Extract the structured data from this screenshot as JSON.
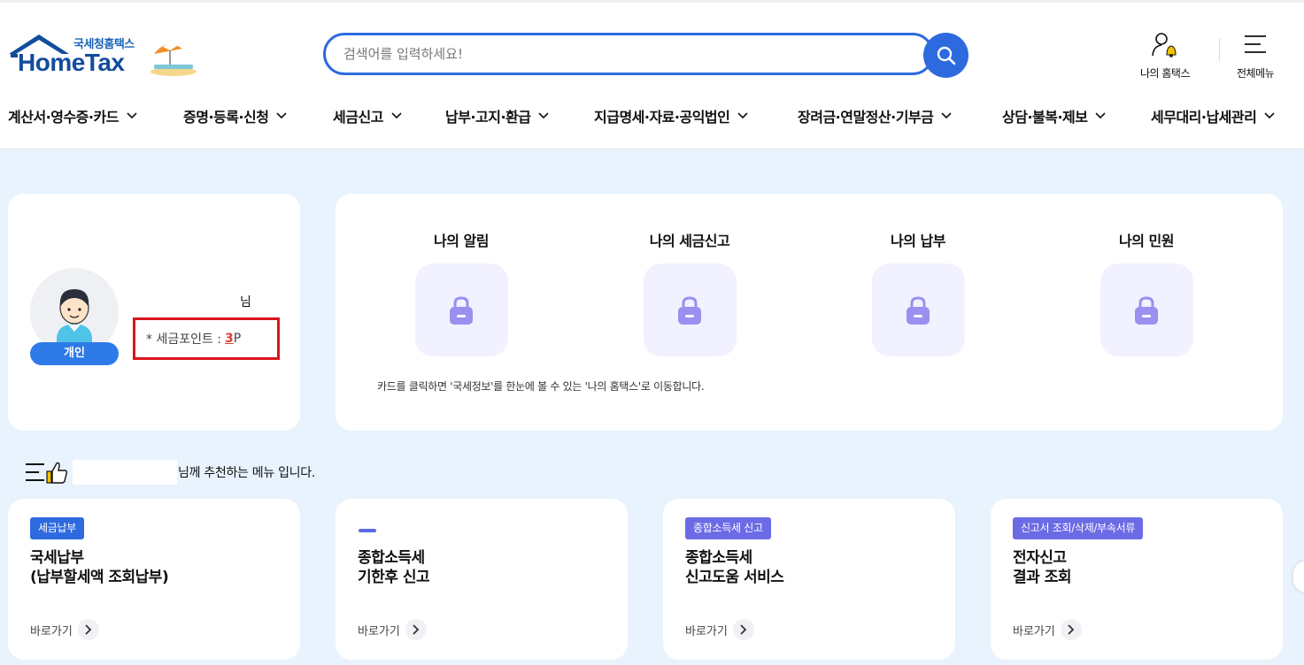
{
  "logo": {
    "sub": "국세청홈택스",
    "main": "HomeTax"
  },
  "search": {
    "placeholder": "검색어를 입력하세요!"
  },
  "util": {
    "my_hometax": "나의 홈택스",
    "all_menu": "전체메뉴"
  },
  "nav": [
    "계산서·영수증·카드",
    "증명·등록·신청",
    "세금신고",
    "납부·고지·환급",
    "지급명세·자료·공익법인",
    "장려금·연말정산·기부금",
    "상담·불복·제보",
    "세무대리·납세관리"
  ],
  "profile": {
    "name_suffix": "님",
    "type_badge": "개인",
    "points_label": "* 세금포인트 :",
    "points_value": "3",
    "points_unit": "P"
  },
  "my": {
    "items": [
      "나의 알림",
      "나의 세금신고",
      "나의 납부",
      "나의 민원"
    ],
    "note": "카드를 클릭하면 '국세정보'를 한눈에 볼 수 있는 '나의 홈택스'로 이동합니다."
  },
  "recommend": {
    "text": "님께 추천하는 메뉴 입니다."
  },
  "menu_cards": [
    {
      "tag": "세금납부",
      "title1": "국세납부",
      "title2": "(납부할세액 조회납부)",
      "link": "바로가기"
    },
    {
      "tag": "",
      "title1": "종합소득세",
      "title2": "기한후 신고",
      "link": "바로가기"
    },
    {
      "tag": "종합소득세 신고",
      "title1": "종합소득세",
      "title2": "신고도움 서비스",
      "link": "바로가기"
    },
    {
      "tag": "신고서 조회/삭제/부속서류",
      "title1": "전자신고",
      "title2": "결과 조회",
      "link": "바로가기"
    }
  ],
  "colors": {
    "primary": "#2d6ae0",
    "tag_purple": "#6b6be6",
    "highlight_border": "#d9141d",
    "page_bg": "#e8f3fd",
    "lock_bg": "#f2f1ff",
    "lock": "#9b8ff0"
  }
}
